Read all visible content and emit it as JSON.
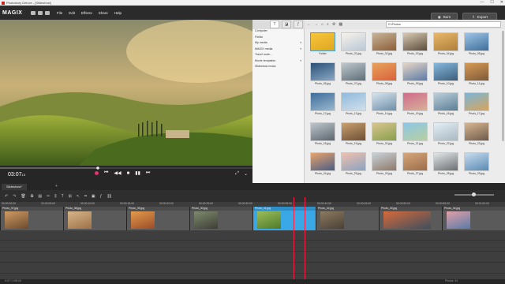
{
  "window": {
    "title": "Photostory Deluxe - [Slideshow]",
    "minimize": "—",
    "maximize": "☐",
    "close": "✕"
  },
  "menubar": {
    "logo": "MAGIX",
    "menus": [
      "File",
      "Edit",
      "Effects",
      "Share",
      "Help"
    ],
    "burn_label": "Burn",
    "export_label": "Export"
  },
  "player": {
    "timecode": "03:07",
    "timecode_frames": "13"
  },
  "media": {
    "path": "D:\\Photos",
    "tree": [
      {
        "label": "Computer",
        "arrow": ""
      },
      {
        "label": "Förlän",
        "arrow": ""
      },
      {
        "label": "My media",
        "arrow": "▾"
      },
      {
        "label": "MAGIX media",
        "arrow": "▾"
      },
      {
        "label": "Travel route...",
        "arrow": ""
      },
      {
        "label": "Movie templates",
        "arrow": "▾"
      },
      {
        "label": "Slideshow music",
        "arrow": ""
      }
    ],
    "thumbs": [
      {
        "label": "Folder",
        "c1": "#f6c53a",
        "c2": "#e0a722"
      },
      {
        "label": "Photo_01.jpg",
        "c1": "#f7f3ea",
        "c2": "#b9c7d6"
      },
      {
        "label": "Photo_02.jpg",
        "c1": "#c7b59a",
        "c2": "#8d5e38"
      },
      {
        "label": "Photo_03.jpg",
        "c1": "#d7c9b3",
        "c2": "#5c4c3c"
      },
      {
        "label": "Photo_04.jpg",
        "c1": "#e7b86a",
        "c2": "#b07e3a"
      },
      {
        "label": "Photo_05.jpg",
        "c1": "#9fc5e6",
        "c2": "#3e6e9a"
      },
      {
        "label": "Photo_06.jpg",
        "c1": "#2b4f75",
        "c2": "#8aa9c6"
      },
      {
        "label": "Photo_07.jpg",
        "c1": "#bfc8cd",
        "c2": "#5e6e78"
      },
      {
        "label": "Photo_08.jpg",
        "c1": "#e8a35c",
        "c2": "#d9613b"
      },
      {
        "label": "Photo_09.jpg",
        "c1": "#e6d6c6",
        "c2": "#5b7aa6"
      },
      {
        "label": "Photo_10.jpg",
        "c1": "#86b8de",
        "c2": "#3d5d7a"
      },
      {
        "label": "Photo_11.jpg",
        "c1": "#d89b54",
        "c2": "#7d5a3a"
      },
      {
        "label": "Photo_12.jpg",
        "c1": "#3e6d99",
        "c2": "#9ab8cf"
      },
      {
        "label": "Photo_13.jpg",
        "c1": "#8fb9dd",
        "c2": "#d2e0ea"
      },
      {
        "label": "Photo_14.jpg",
        "c1": "#d7e4ee",
        "c2": "#6d8ea8"
      },
      {
        "label": "Photo_15.jpg",
        "c1": "#cf6b8a",
        "c2": "#d8b19a"
      },
      {
        "label": "Photo_16.jpg",
        "c1": "#bdcfd9",
        "c2": "#5a7e96"
      },
      {
        "label": "Photo_17.jpg",
        "c1": "#7ab6d9",
        "c2": "#d8a45a"
      },
      {
        "label": "Photo_18.jpg",
        "c1": "#bfc6cc",
        "c2": "#5c6670"
      },
      {
        "label": "Photo_19.jpg",
        "c1": "#caa06e",
        "c2": "#6c4f35"
      },
      {
        "label": "Photo_20.jpg",
        "c1": "#d8c48f",
        "c2": "#88a04c"
      },
      {
        "label": "Photo_21.jpg",
        "c1": "#8cc6e6",
        "c2": "#b8d0a0"
      },
      {
        "label": "Photo_22.jpg",
        "c1": "#e4eef4",
        "c2": "#a9b8c2"
      },
      {
        "label": "Photo_23.jpg",
        "c1": "#d8b692",
        "c2": "#6e5a4a"
      },
      {
        "label": "Photo_24.jpg",
        "c1": "#e8a36b",
        "c2": "#4a5e86"
      },
      {
        "label": "Photo_25.jpg",
        "c1": "#f0c0ae",
        "c2": "#8aa3c0"
      },
      {
        "label": "Photo_26.jpg",
        "c1": "#c8d2da",
        "c2": "#8e7a68"
      },
      {
        "label": "Photo_27.jpg",
        "c1": "#d6a67c",
        "c2": "#9b6e4a"
      },
      {
        "label": "Photo_28.jpg",
        "c1": "#e2e7ea",
        "c2": "#6b6e72"
      },
      {
        "label": "Photo_29.jpg",
        "c1": "#c7dced",
        "c2": "#5a8ab4"
      }
    ]
  },
  "arranger": {
    "tab_label": "Slideshow*",
    "add_tab": "+",
    "ruler": [
      "00:00:00:00",
      "00:00:05:00",
      "00:00:10:00",
      "00:00:15:00",
      "00:00:20:00",
      "00:00:25:00",
      "00:00:30:00",
      "00:00:35:00",
      "00:00:40:00",
      "00:00:45:00",
      "00:00:50:00",
      "00:00:55:00",
      "00:01:00:00",
      "00:01:05:00"
    ],
    "clips": [
      {
        "label": "Photo_37.jpg",
        "c1": "#cf9a62",
        "c2": "#6b4b2e"
      },
      {
        "label": "Photo_38.jpg",
        "c1": "#d6b48a",
        "c2": "#9e7248"
      },
      {
        "label": "Photo_39.jpg",
        "c1": "#e39a4a",
        "c2": "#9a4d2a"
      },
      {
        "label": "Photo_40.jpg",
        "c1": "#7d8a6e",
        "c2": "#3e3e34"
      },
      {
        "label": "Photo_41.jpg",
        "c1": "#9bbd5a",
        "c2": "#4e7a2a"
      },
      {
        "label": "Photo_42.jpg",
        "c1": "#8c7a62",
        "c2": "#4a4034"
      },
      {
        "label": "Photo_43.jpg",
        "c1": "#d66a3a",
        "c2": "#3e4e5e"
      },
      {
        "label": "Photo_44.jpg",
        "c1": "#e0a0a8",
        "c2": "#5a7aa8"
      }
    ]
  },
  "status": {
    "left": "3:07 / 1:08:15",
    "right": "Photos: 44"
  }
}
